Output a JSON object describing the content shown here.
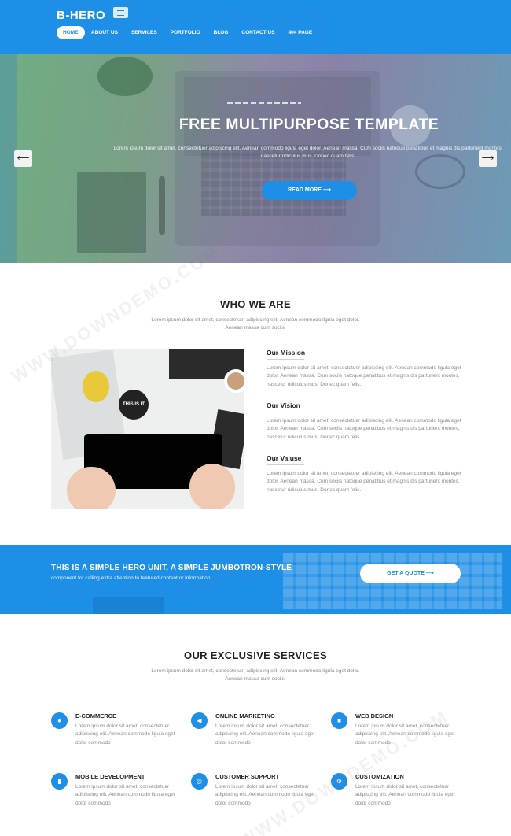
{
  "header": {
    "brand": "B-HERO",
    "nav": [
      "HOME",
      "ABOUT US",
      "SERVICES",
      "PORTFOLIO",
      "BLOG",
      "CONTACT US",
      "404 PAGE"
    ],
    "active_index": 0
  },
  "hero": {
    "title": "FREE MULTIPURPOSE TEMPLATE",
    "text": "Lorem ipsum dolor sit amet, consectetuer adipiscing elit. Aenean commodo ligula eget dolor. Aenean massa. Cum sociis natoque penatibus et magnis dis parturient montes, nascetur ridiculus mus. Donec quam felis.",
    "button": "READ MORE ⟶",
    "prev": "⟵",
    "next": "⟶"
  },
  "about": {
    "title": "WHO WE ARE",
    "subtitle": "Lorem ipsum dolor sit amet, consectetuer adipiscing elit. Aenean commodo ligula eget dolor. Aenean massa cum sociis.",
    "image_badge": "THIS IS IT",
    "blocks": [
      {
        "title": "Our Mission",
        "text": "Lorem ipsum dolor sit amet, consectetuer adipiscing elit. Aenean commodo ligula eget dolor. Aenean massa. Cum sociis natoque penatibus et magnis dis parturient montes, nascetur ridiculus mus. Donec quam felis."
      },
      {
        "title": "Our Vision",
        "text": "Lorem ipsum dolor sit amet, consectetuer adipiscing elit. Aenean commodo ligula eget dolor. Aenean massa. Cum sociis natoque penatibus et magnis dis parturient montes, nascetur ridiculus mus. Donec quam felis."
      },
      {
        "title": "Our Valuse",
        "text": "Lorem ipsum dolor sit amet, consectetuer adipiscing elit. Aenean commodo ligula eget dolor. Aenean massa. Cum sociis natoque penatibus et magnis dis parturient montes, nascetur ridiculus mus. Donec quam felis."
      }
    ]
  },
  "cta": {
    "title": "THIS IS A SIMPLE HERO UNIT, A SIMPLE JUMBOTRON-STYLE",
    "subtitle": "component for calling extra attention to featured content or information.",
    "button": "GET A QUOTE ⟶"
  },
  "services": {
    "title": "OUR EXCLUSIVE SERVICES",
    "subtitle": "Lorem ipsum dolor sit amet, consectetuer adipiscing elit. Aenean commodo ligula eget dolor. Aenean massa cum sociis.",
    "items": [
      {
        "icon": "cart-icon",
        "glyph": "●",
        "title": "E-COMMERCE",
        "text": "Lorem ipsum dolor sit amet, consectetuer adipiscing elit. Aenean commodo ligula eget dolor commodo"
      },
      {
        "icon": "megaphone-icon",
        "glyph": "◀",
        "title": "ONLINE MARKETING",
        "text": "Lorem ipsum dolor sit amet, consectetuer adipiscing elit. Aenean commodo ligula eget dolor commodo"
      },
      {
        "icon": "monitor-icon",
        "glyph": "■",
        "title": "WEB DESIGN",
        "text": "Lorem ipsum dolor sit amet, consectetuer adipiscing elit. Aenean commodo ligula eget dolor commodo"
      },
      {
        "icon": "mobile-icon",
        "glyph": "▮",
        "title": "MOBILE DEVELOPMENT",
        "text": "Lorem ipsum dolor sit amet, consectetuer adipiscing elit. Aenean commodo ligula eget dolor commodo"
      },
      {
        "icon": "support-icon",
        "glyph": "◎",
        "title": "CUSTOMER SUPPORT",
        "text": "Lorem ipsum dolor sit amet, consectetuer adipiscing elit. Aenean commodo ligula eget dolor commodo"
      },
      {
        "icon": "gear-icon",
        "glyph": "⚙",
        "title": "CUSTOMIZATION",
        "text": "Lorem ipsum dolor sit amet, consectetuer adipiscing elit. Aenean commodo ligula eget dolor commodo"
      }
    ]
  },
  "watermark": "WWW.DOWNDEMO.COM",
  "colors": {
    "primary": "#1e8fe6",
    "white": "#ffffff",
    "text_dark": "#222222",
    "text_muted": "#8a8a8a"
  }
}
